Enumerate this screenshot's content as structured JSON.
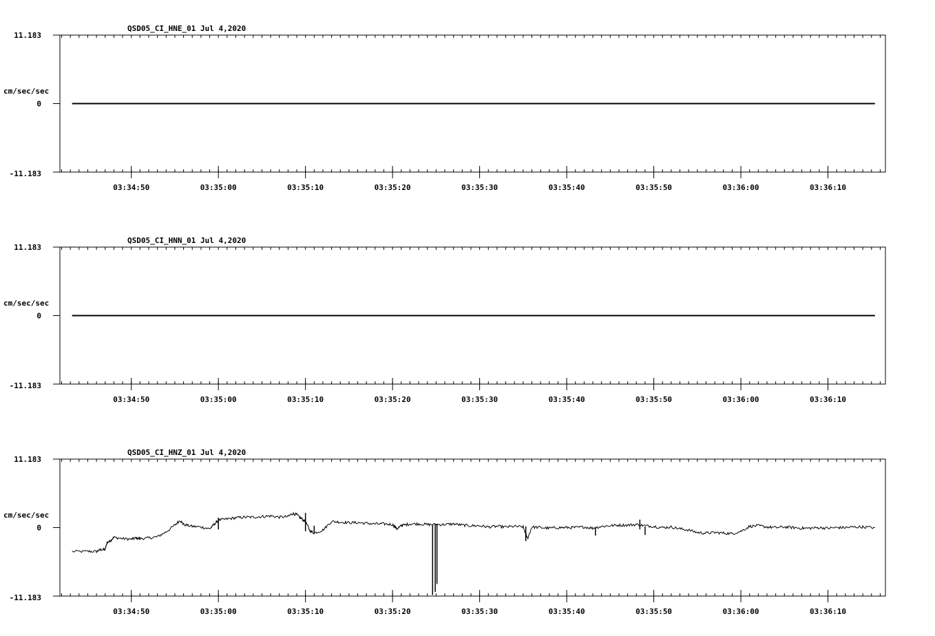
{
  "chart_data": [
    {
      "type": "line",
      "title": "QSD05_CI_HNE_01  Jul 4,2020",
      "ylabel": "cm/sec/sec",
      "ytick_labels": [
        "11.183",
        "0",
        "-11.183"
      ],
      "ylim": [
        -11.183,
        11.183
      ],
      "xlim_seconds": [
        41.8,
        136.6
      ],
      "xticks": [
        "03:34:50",
        "03:35:00",
        "03:35:10",
        "03:35:20",
        "03:35:30",
        "03:35:40",
        "03:35:50",
        "03:36:00",
        "03:36:10"
      ],
      "series": [
        {
          "style": "flat",
          "x_range_seconds": [
            43.2,
            135.4
          ],
          "value": 0
        }
      ]
    },
    {
      "type": "line",
      "title": "QSD05_CI_HNN_01  Jul 4,2020",
      "ylabel": "cm/sec/sec",
      "ytick_labels": [
        "11.183",
        "0",
        "-11.183"
      ],
      "ylim": [
        -11.183,
        11.183
      ],
      "xlim_seconds": [
        41.8,
        136.6
      ],
      "xticks": [
        "03:34:50",
        "03:35:00",
        "03:35:10",
        "03:35:20",
        "03:35:30",
        "03:35:40",
        "03:35:50",
        "03:36:00",
        "03:36:10"
      ],
      "series": [
        {
          "style": "flat",
          "x_range_seconds": [
            43.2,
            135.4
          ],
          "value": 0
        }
      ]
    },
    {
      "type": "line",
      "title": "QSD05_CI_HNZ_01  Jul 4,2020",
      "ylabel": "cm/sec/sec",
      "ytick_labels": [
        "11.183",
        "0",
        "-11.183"
      ],
      "ylim": [
        -11.183,
        11.183
      ],
      "xlim_seconds": [
        41.8,
        136.6
      ],
      "xticks": [
        "03:34:50",
        "03:35:00",
        "03:35:10",
        "03:35:20",
        "03:35:30",
        "03:35:40",
        "03:35:50",
        "03:36:00",
        "03:36:10"
      ],
      "series": [
        {
          "style": "trace",
          "x_seconds": [
            43.2,
            45.0,
            46.0,
            46.5,
            47.0,
            47.2,
            47.6,
            48.0,
            49.0,
            50.0,
            50.5,
            51.0,
            52.0,
            53.0,
            54.0,
            55.0,
            55.6,
            56.0,
            57.0,
            58.0,
            59.0,
            59.5,
            60.0,
            61.0,
            62.0,
            63.0,
            64.0,
            65.0,
            66.0,
            67.0,
            68.0,
            68.5,
            69.0,
            69.5,
            70.0,
            70.5,
            71.0,
            72.0,
            73.0,
            74.0,
            75.0,
            76.0,
            77.0,
            78.0,
            79.0,
            80.0,
            80.5,
            81.0,
            81.2,
            82.0,
            83.0,
            84.0,
            85.0,
            86.0,
            87.0,
            88.0,
            89.0,
            90.0,
            91.0,
            92.0,
            93.0,
            94.0,
            95.0,
            95.5,
            96.0,
            97.0,
            98.0,
            99.0,
            100.0,
            101.0,
            102.0,
            103.0,
            104.0,
            105.0,
            106.0,
            107.0,
            108.0,
            109.0,
            110.0,
            111.0,
            112.0,
            113.0,
            114.0,
            115.0,
            116.0,
            117.0,
            118.0,
            119.0,
            120.0,
            121.0,
            122.0,
            123.0,
            124.0,
            125.0,
            126.0,
            127.0,
            128.0,
            129.0,
            130.0,
            131.0,
            132.0,
            133.0,
            134.0,
            135.4
          ],
          "values": [
            -3.9,
            -3.9,
            -3.9,
            -3.6,
            -3.6,
            -2.5,
            -2.1,
            -1.6,
            -1.8,
            -1.9,
            -1.7,
            -1.8,
            -1.7,
            -1.5,
            -0.7,
            0.4,
            1.2,
            0.5,
            0.2,
            0.1,
            -0.2,
            0.5,
            1.2,
            1.4,
            1.6,
            1.7,
            1.7,
            1.8,
            1.9,
            1.7,
            1.8,
            2.3,
            2.1,
            1.5,
            1.0,
            -0.5,
            -0.9,
            -0.4,
            1.0,
            0.9,
            0.8,
            0.8,
            0.7,
            0.6,
            0.6,
            0.5,
            -0.2,
            0.3,
            0.4,
            0.6,
            0.6,
            0.5,
            0.5,
            0.5,
            0.6,
            0.4,
            0.3,
            0.3,
            0.1,
            0.2,
            0.1,
            0.2,
            0.1,
            -1.8,
            0.1,
            0.0,
            -0.1,
            0.0,
            0.0,
            0.0,
            0.1,
            -0.1,
            0.2,
            0.3,
            0.4,
            0.4,
            0.5,
            0.3,
            0.2,
            0.0,
            0.1,
            -0.2,
            -0.4,
            -0.8,
            -0.9,
            -0.8,
            -0.9,
            -1.0,
            -0.6,
            0.2,
            0.3,
            0.1,
            0.0,
            0.1,
            0.0,
            -0.1,
            -0.1,
            0.0,
            -0.1,
            0.0,
            0.0,
            0.1,
            0.1,
            0.0
          ],
          "spikes": [
            {
              "x_seconds": 84.6,
              "min": -11.0,
              "max": 0.5
            },
            {
              "x_seconds": 84.9,
              "min": -10.5,
              "max": 0.6
            },
            {
              "x_seconds": 85.1,
              "min": -9.2,
              "max": 0.6
            },
            {
              "x_seconds": 95.3,
              "min": -2.2,
              "max": 0.2
            },
            {
              "x_seconds": 103.3,
              "min": -1.3,
              "max": 0.1
            },
            {
              "x_seconds": 108.4,
              "min": -0.3,
              "max": 1.3
            },
            {
              "x_seconds": 109.0,
              "min": -1.2,
              "max": 0.2
            },
            {
              "x_seconds": 60.0,
              "min": -0.3,
              "max": 1.6
            },
            {
              "x_seconds": 70.0,
              "min": -0.6,
              "max": 2.4
            },
            {
              "x_seconds": 71.0,
              "min": -1.0,
              "max": 0.3
            }
          ]
        }
      ]
    }
  ]
}
